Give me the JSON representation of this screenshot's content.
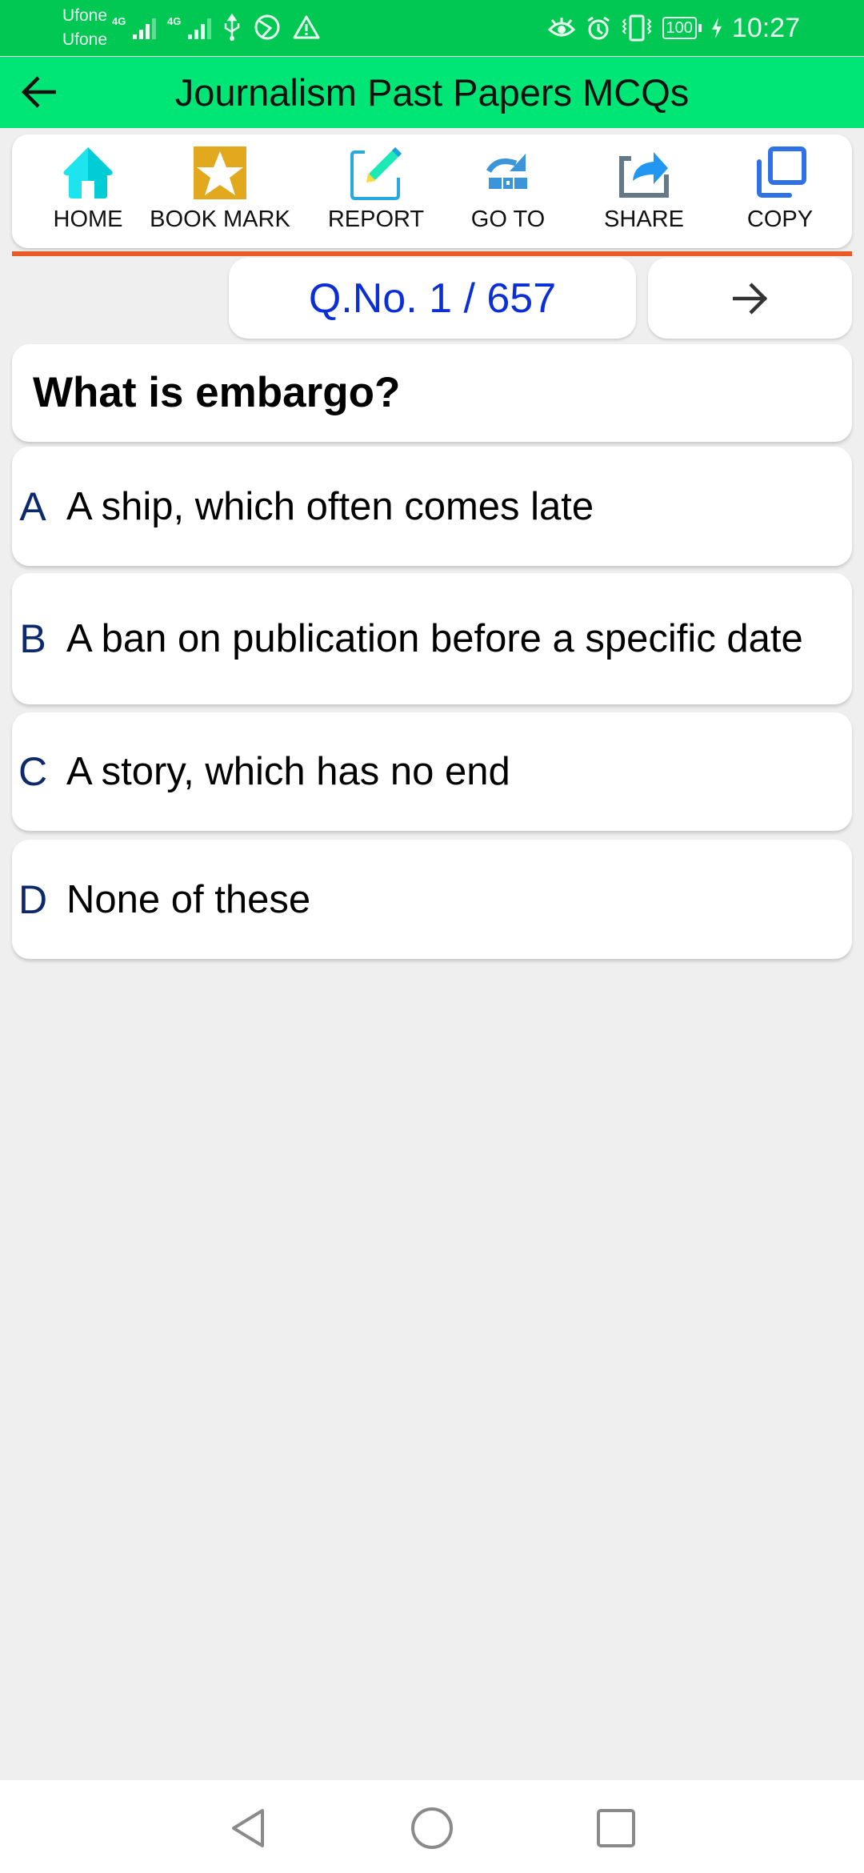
{
  "status_bar": {
    "carrier_1": "Ufone",
    "carrier_2": "Ufone",
    "network_1": "4G",
    "network_2": "4G",
    "icons": [
      "signal-icon",
      "signal-icon",
      "usb-icon",
      "data-saver-icon",
      "warning-icon",
      "eye-comfort-icon",
      "alarm-icon",
      "vibrate-icon",
      "battery-icon",
      "charging-icon"
    ],
    "battery": "100",
    "time": "10:27"
  },
  "app_bar": {
    "title": "Journalism Past Papers MCQs",
    "back_icon": "arrow-left-icon"
  },
  "toolbar": {
    "items": [
      {
        "label": "HOME",
        "icon": "home-icon"
      },
      {
        "label": "BOOK MARK",
        "icon": "star-icon"
      },
      {
        "label": "REPORT",
        "icon": "edit-icon"
      },
      {
        "label": "GO TO",
        "icon": "goto-icon"
      },
      {
        "label": "SHARE",
        "icon": "share-icon"
      },
      {
        "label": "COPY",
        "icon": "copy-icon"
      }
    ]
  },
  "question_nav": {
    "counter": "Q.No. 1 / 657",
    "current": 1,
    "total": 657,
    "next_icon": "arrow-right-icon"
  },
  "question": {
    "text": "What is embargo?",
    "options": [
      {
        "letter": "A",
        "text": "A ship, which often comes late"
      },
      {
        "letter": "B",
        "text": "A ban on publication before a specific date"
      },
      {
        "letter": "C",
        "text": "A story, which has no end"
      },
      {
        "letter": "D",
        "text": "None of these"
      }
    ]
  },
  "colors": {
    "status_bar": "#00c853",
    "app_bar": "#00e676",
    "divider": "#e95a26",
    "counter_text": "#0a2fd6",
    "option_letter": "#0c2a6b"
  },
  "nav_bar": {
    "icons": [
      "back-triangle-icon",
      "home-circle-icon",
      "recents-square-icon"
    ]
  }
}
